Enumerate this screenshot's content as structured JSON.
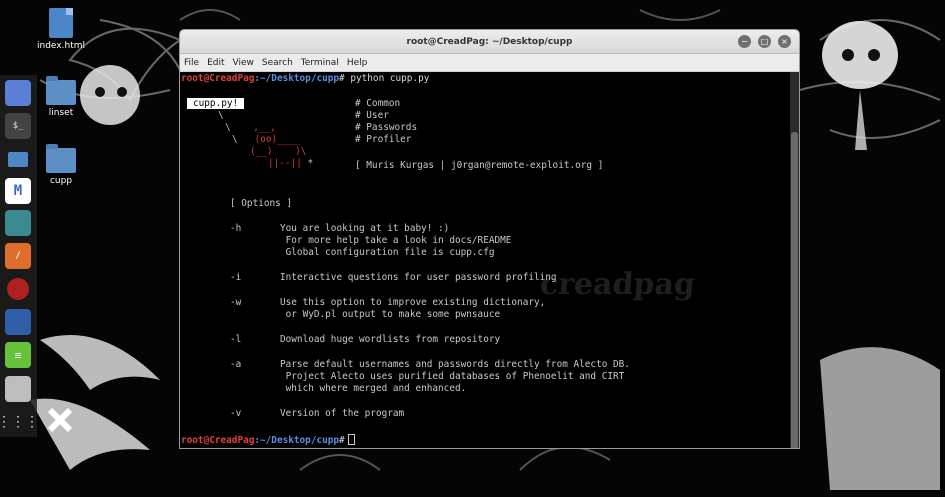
{
  "desktop": {
    "icons": [
      {
        "label": "index.html",
        "type": "file"
      },
      {
        "label": "linset",
        "type": "folder"
      },
      {
        "label": "cupp",
        "type": "folder"
      }
    ],
    "dock": [
      {
        "name": "browser-icon",
        "color": "#5b7fd6"
      },
      {
        "name": "terminal-icon",
        "color": "#222222",
        "glyph": "$_"
      },
      {
        "name": "files-icon",
        "color": "#4f86c6"
      },
      {
        "name": "metasploit-icon",
        "color": "#3f68c2"
      },
      {
        "name": "armitage-icon",
        "color": "#3c8a91"
      },
      {
        "name": "burpsuite-icon",
        "color": "#e06d2d"
      },
      {
        "name": "faraday-icon",
        "color": "#b02020"
      },
      {
        "name": "beef-icon",
        "color": "#2e5fa8"
      },
      {
        "name": "leafpad-icon",
        "color": "#66c23a"
      },
      {
        "name": "cherrytree-icon",
        "color": "#bdbdbd"
      },
      {
        "name": "apps-grid-icon",
        "color": "#cfcfcf"
      }
    ]
  },
  "window": {
    "title": "root@CreadPag: ~/Desktop/cupp",
    "controls": [
      "−",
      "□",
      "×"
    ],
    "menu": [
      "File",
      "Edit",
      "View",
      "Search",
      "Terminal",
      "Help"
    ]
  },
  "terminal": {
    "prompt_user": "root@CreadPag",
    "prompt_path": ":~/Desktop/cupp",
    "prompt_symbol": "#",
    "command": " python cupp.py",
    "banner_badge": "cupp.py!",
    "banner_lines": [
      "# Common",
      "# User",
      "# Passwords",
      "# Profiler"
    ],
    "credit": "[ Muris Kurgas | j0rgan@remote-exploit.org ]",
    "options_header": "[ Options ]",
    "options": [
      {
        "flag": "-h",
        "desc": [
          "You are looking at it baby! :)",
          " For more help take a look in docs/README",
          " Global configuration file is cupp.cfg"
        ]
      },
      {
        "flag": "-i",
        "desc": [
          "Interactive questions for user password profiling"
        ]
      },
      {
        "flag": "-w",
        "desc": [
          "Use this option to improve existing dictionary,",
          " or WyD.pl output to make some pwnsauce"
        ]
      },
      {
        "flag": "-l",
        "desc": [
          "Download huge wordlists from repository"
        ]
      },
      {
        "flag": "-a",
        "desc": [
          "Parse default usernames and passwords directly from Alecto DB.",
          " Project Alecto uses purified databases of Phenoelit and CIRT",
          " which where merged and enhanced."
        ]
      },
      {
        "flag": "-v",
        "desc": [
          "Version of the program"
        ]
      }
    ]
  },
  "watermark": "creadpag"
}
